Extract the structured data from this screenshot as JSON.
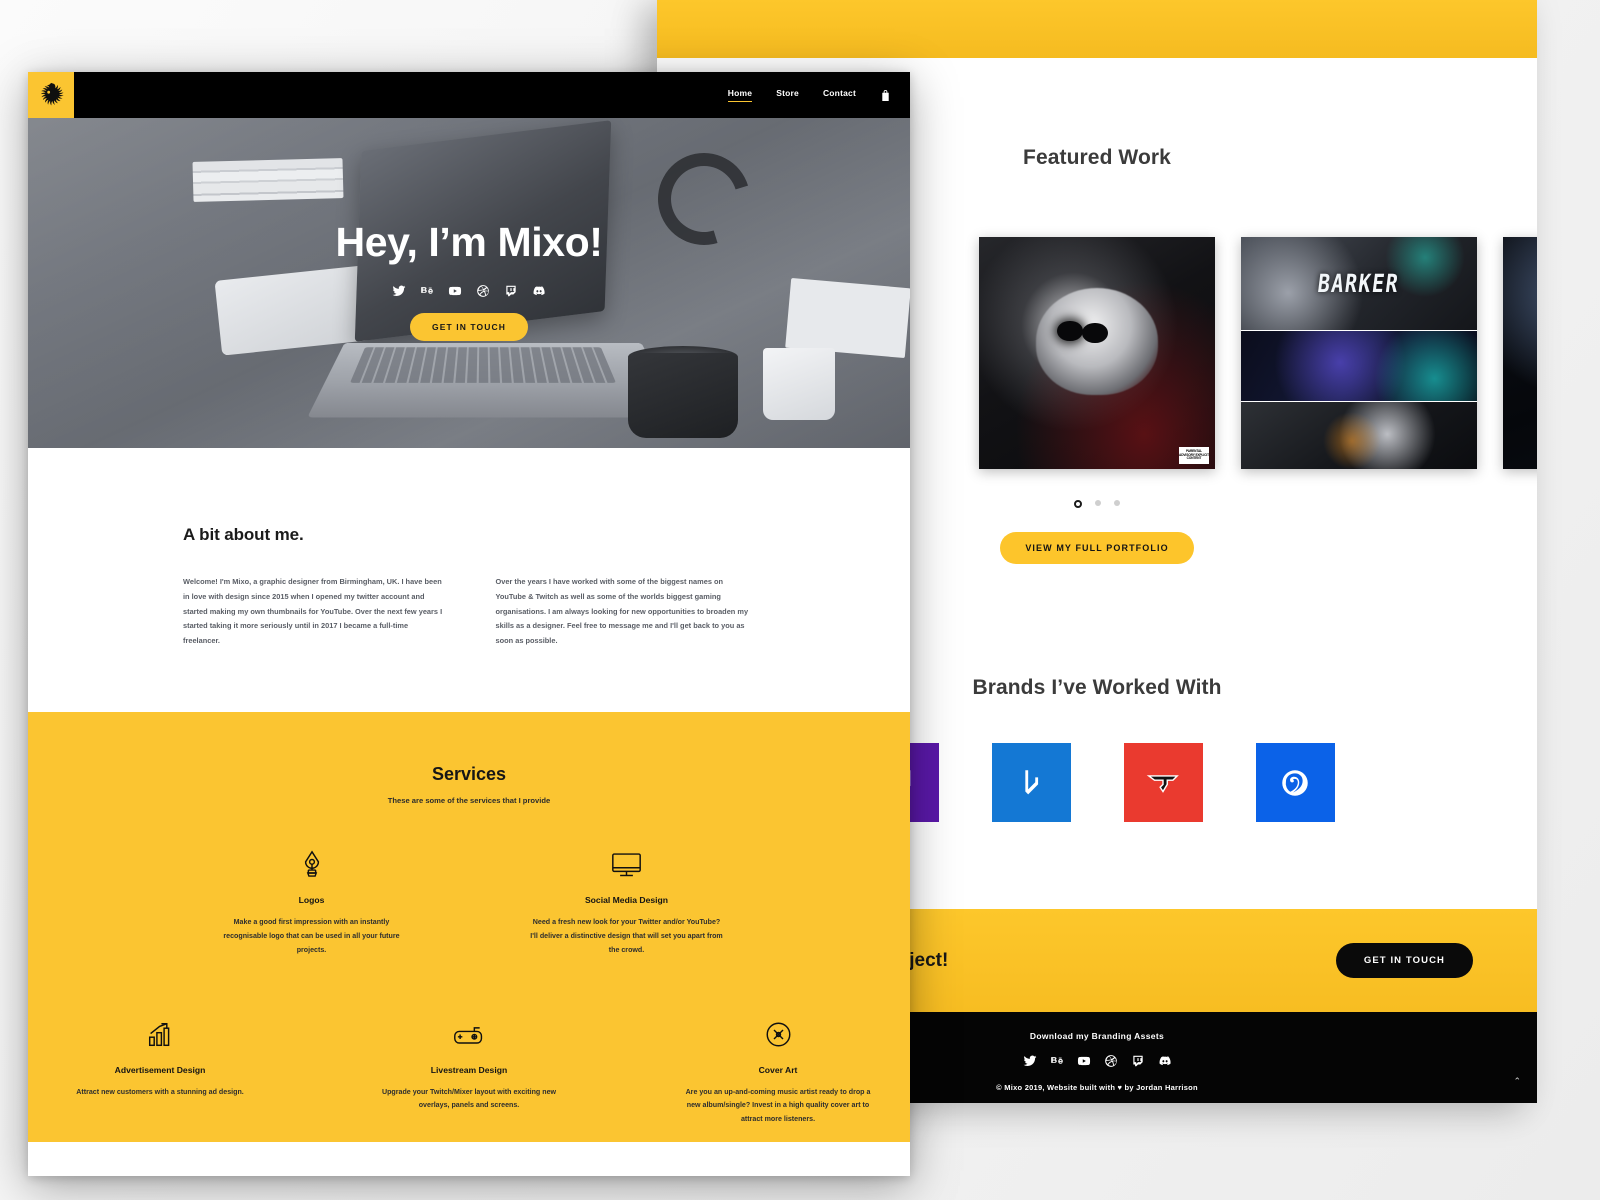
{
  "colors": {
    "brand_yellow": "#fbc531",
    "dark": "#000000",
    "text_grey": "#5a5e66"
  },
  "front_window": {
    "nav": {
      "logo_name": "mixo-lion-logo",
      "links": [
        {
          "label": "Home",
          "active": true
        },
        {
          "label": "Store",
          "active": false
        },
        {
          "label": "Contact",
          "active": false
        }
      ],
      "cart_icon": "shopping-bag-icon"
    },
    "hero": {
      "title": "Hey, I’m Mixo!",
      "social": [
        "twitter-icon",
        "behance-icon",
        "youtube-icon",
        "dribbble-icon",
        "twitch-icon",
        "discord-icon"
      ],
      "cta_label": "GET IN TOUCH"
    },
    "about": {
      "title": "A bit about me.",
      "paragraph_left": "Welcome! I'm Mixo, a graphic designer from Birmingham, UK. I have been in love with design since 2015 when I opened my twitter account and started making my own thumbnails for YouTube. Over the next few years I started taking it more seriously until in 2017 I became a full-time freelancer.",
      "paragraph_right": "Over the years I have worked with some of the biggest names on YouTube & Twitch as well as some of the worlds biggest gaming organisations. I am always looking for new opportunities to broaden my skills as a designer. Feel free to message me and I'll get back to you as soon as possible."
    },
    "services": {
      "title": "Services",
      "subtitle": "These are some of the services that I provide",
      "items": [
        {
          "icon": "pen-nib-icon",
          "name": "Logos",
          "desc": "Make a good first impression with an instantly recognisable logo that can be used in all your future projects."
        },
        {
          "icon": "monitor-icon",
          "name": "Social Media Design",
          "desc": "Need a fresh new look for your Twitter and/or YouTube? I'll deliver a distinctive design that will set you apart from the crowd."
        },
        {
          "icon": "bar-chart-growth-icon",
          "name": "Advertisement Design",
          "desc": "Attract new customers with a stunning ad design."
        },
        {
          "icon": "gamepad-icon",
          "name": "Livestream Design",
          "desc": "Upgrade your Twitch/Mixer layout with exciting new overlays, panels and screens."
        },
        {
          "icon": "compact-disc-icon",
          "name": "Cover Art",
          "desc": "Are you an up-and-coming music artist ready to drop a new album/single? Invest in a high quality cover art to attract more listeners."
        }
      ]
    }
  },
  "back_window": {
    "featured": {
      "title": "Featured Work",
      "items": [
        {
          "name": "dark-nebula-artwork",
          "label": ""
        },
        {
          "name": "skull-album-cover-artwork",
          "label": ""
        },
        {
          "name": "barker-banner-artwork",
          "label": "BARKER"
        },
        {
          "name": "dark-nebula-artwork-2",
          "label": ""
        }
      ],
      "parental_advisory": "PARENTAL ADVISORY EXPLICIT CONTENT",
      "carousel_dots": 3,
      "active_dot": 0,
      "portfolio_button": "VIEW MY FULL PORTFOLIO"
    },
    "brands": {
      "title": "Brands I’ve Worked With",
      "items": [
        {
          "name": "twitch-brand-tile",
          "glyph": "≡",
          "color": "#5a18a8"
        },
        {
          "name": "brawlhalla-brand-tile",
          "glyph": "b",
          "color": "#1478d4"
        },
        {
          "name": "faze-clan-brand-tile",
          "glyph": "Ŧ",
          "color": "#ea3a2f"
        },
        {
          "name": "dignitas-brand-tile",
          "glyph": "Đ",
          "color": "#0b62e8"
        }
      ]
    },
    "cta": {
      "text": "out your next project!",
      "button": "GET IN TOUCH"
    },
    "footer": {
      "assets_label": "Download my Branding Assets",
      "social": [
        "twitter-icon",
        "behance-icon",
        "youtube-icon",
        "dribbble-icon",
        "twitch-icon",
        "discord-icon"
      ],
      "copyright": "© Mixo 2019, Website built with ♥ by Jordan Harrison",
      "back_to_top": "⌃"
    }
  }
}
